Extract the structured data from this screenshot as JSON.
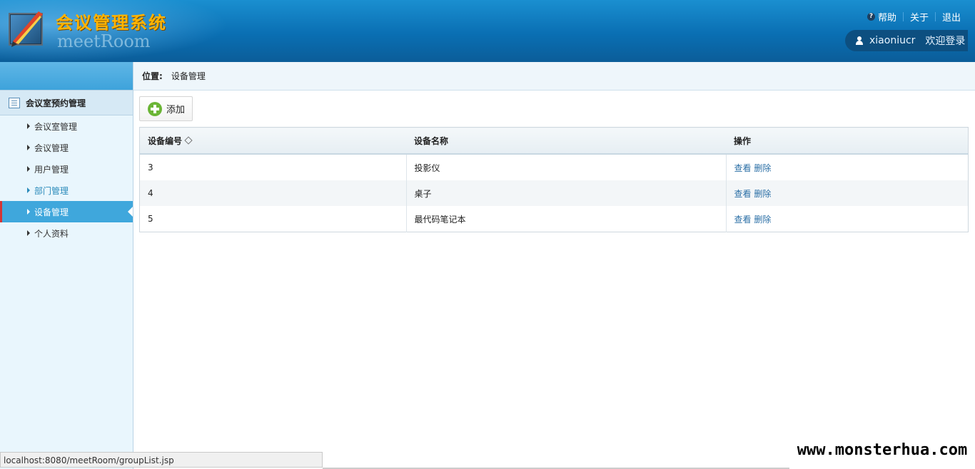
{
  "header": {
    "title": "会议管理系统",
    "subtitle": "meetRoom",
    "links": {
      "help": "帮助",
      "about": "关于",
      "logout": "退出"
    },
    "user": {
      "name": "xiaoniucr",
      "welcome": "欢迎登录"
    }
  },
  "breadcrumb": {
    "label": "位置:",
    "current": "设备管理"
  },
  "sidebar": {
    "section": "会议室预约管理",
    "items": [
      {
        "label": "会议室管理"
      },
      {
        "label": "会议管理"
      },
      {
        "label": "用户管理"
      },
      {
        "label": "部门管理"
      },
      {
        "label": "设备管理"
      },
      {
        "label": "个人资料"
      }
    ]
  },
  "toolbar": {
    "add_label": "添加"
  },
  "table": {
    "headers": [
      "设备编号",
      "设备名称",
      "操作"
    ],
    "rows": [
      {
        "id": "3",
        "name": "投影仪",
        "view": "查看",
        "delete": "删除"
      },
      {
        "id": "4",
        "name": "桌子",
        "view": "查看",
        "delete": "删除"
      },
      {
        "id": "5",
        "name": "最代码笔记本",
        "view": "查看",
        "delete": "删除"
      }
    ]
  },
  "status_bar": {
    "url": "localhost:8080/meetRoom/groupList.jsp"
  },
  "watermark": "www.monsterhua.com",
  "colors": {
    "header_blue": "#0a6fb3",
    "accent_gold": "#ffb400",
    "active_menu": "#3fa7dc",
    "active_marker": "#d43535",
    "link": "#2b6fa6"
  }
}
